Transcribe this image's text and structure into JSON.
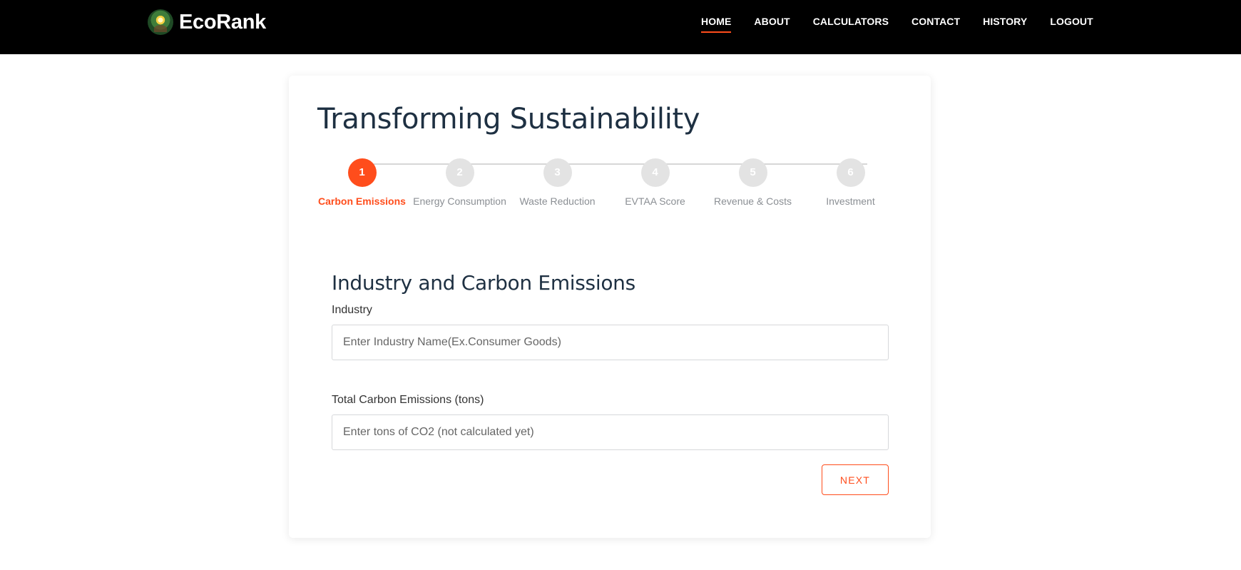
{
  "header": {
    "brand": "EcoRank",
    "logo_icon": "eco-globe-logo",
    "nav": [
      {
        "label": "HOME",
        "active": true
      },
      {
        "label": "ABOUT",
        "active": false
      },
      {
        "label": "CALCULATORS",
        "active": false
      },
      {
        "label": "CONTACT",
        "active": false
      },
      {
        "label": "HISTORY",
        "active": false
      },
      {
        "label": "LOGOUT",
        "active": false
      }
    ]
  },
  "main": {
    "title": "Transforming Sustainability",
    "steps": [
      {
        "number": "1",
        "label": "Carbon Emissions",
        "active": true
      },
      {
        "number": "2",
        "label": "Energy Consumption",
        "active": false
      },
      {
        "number": "3",
        "label": "Waste Reduction",
        "active": false
      },
      {
        "number": "4",
        "label": "EVTAA Score",
        "active": false
      },
      {
        "number": "5",
        "label": "Revenue & Costs",
        "active": false
      },
      {
        "number": "6",
        "label": "Investment",
        "active": false
      }
    ],
    "section_title": "Industry and Carbon Emissions",
    "fields": {
      "industry": {
        "label": "Industry",
        "value": "",
        "placeholder": "Enter Industry Name(Ex.Consumer Goods)"
      },
      "carbon": {
        "label": "Total Carbon Emissions (tons)",
        "value": "",
        "placeholder": "Enter tons of CO2 (not calculated yet)"
      }
    },
    "next_label": "NEXT"
  },
  "colors": {
    "accent": "#ff4d1c",
    "header_bg": "#000000",
    "step_inactive": "#e3e3e3",
    "title": "#1e3042"
  }
}
